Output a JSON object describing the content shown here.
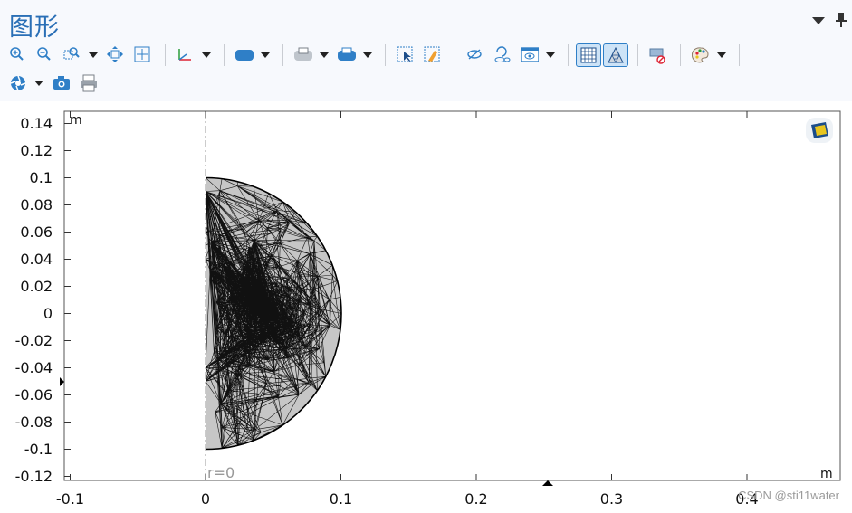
{
  "window": {
    "title": "图形"
  },
  "toolbar_row1": [
    {
      "name": "zoom-in-icon"
    },
    {
      "name": "zoom-out-icon"
    },
    {
      "name": "zoom-box-icon",
      "dropdown": true
    },
    {
      "name": "move-icon"
    },
    {
      "name": "zoom-extents-icon"
    },
    {
      "name": "axis-icon",
      "dropdown": true
    },
    {
      "name": "render-shape-icon",
      "dropdown": true
    },
    {
      "name": "scene-light-icon",
      "dropdown": true
    },
    {
      "name": "transparency-icon",
      "dropdown": true
    },
    {
      "name": "select-box-icon"
    },
    {
      "name": "clear-selection-icon"
    },
    {
      "name": "hide-icon"
    },
    {
      "name": "reset-hiding-icon"
    },
    {
      "name": "view-icon",
      "dropdown": true
    },
    {
      "name": "show-grid-icon",
      "active": true
    },
    {
      "name": "mesh-render-icon",
      "active": true
    },
    {
      "name": "clear-plot-icon"
    },
    {
      "name": "color-palette-icon",
      "dropdown": true
    }
  ],
  "toolbar_row2": [
    {
      "name": "scene-icon",
      "dropdown": true
    },
    {
      "name": "camera-icon"
    },
    {
      "name": "print-icon"
    }
  ],
  "plot": {
    "x_unit": "m",
    "y_unit": "m",
    "x_ticks": [
      "-0.1",
      "0",
      "0.1",
      "0.2",
      "0.3",
      "0.4"
    ],
    "y_ticks": [
      "0.14",
      "0.12",
      "0.1",
      "0.08",
      "0.06",
      "0.04",
      "0.02",
      "0",
      "-0.02",
      "-0.04",
      "-0.06",
      "-0.08",
      "-0.1",
      "-0.12"
    ],
    "axis_label": "r=0",
    "mesh_fill": "#c6c6c6",
    "mesh_stroke": "#111111"
  },
  "watermark": "CSDN @sti11water"
}
